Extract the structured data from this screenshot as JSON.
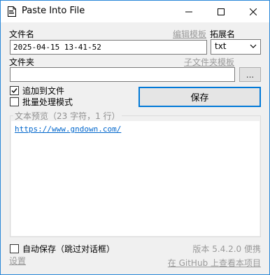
{
  "window": {
    "title": "Paste Into File",
    "minimize": "—",
    "maximize": "☐",
    "close": "✕"
  },
  "filename": {
    "label": "文件名",
    "edit_template_link": "编辑模板",
    "value": "2025-04-15 13-41-52"
  },
  "extension": {
    "label": "拓展名",
    "selected": "txt"
  },
  "folder": {
    "label": "文件夹",
    "subfolder_template_link": "子文件夹模板",
    "value": "",
    "browse_label": "..."
  },
  "options": {
    "append_label": "追加到文件",
    "append_checked": true,
    "batch_label": "批量处理模式",
    "batch_checked": false
  },
  "save_button": "保存",
  "preview": {
    "title": "文本预览（23 字符，1 行）",
    "content": "https://www.gndown.com/"
  },
  "footer": {
    "autosave_label": "自动保存（跳过对话框）",
    "autosave_checked": false,
    "settings_link": "设置",
    "version": "版本 5.4.2.0 便携",
    "github_link": "在 GitHub 上查看本项目"
  },
  "colors": {
    "accent": "#0078d7",
    "link": "#0066cc",
    "disabled_text": "#9a9a9a"
  }
}
